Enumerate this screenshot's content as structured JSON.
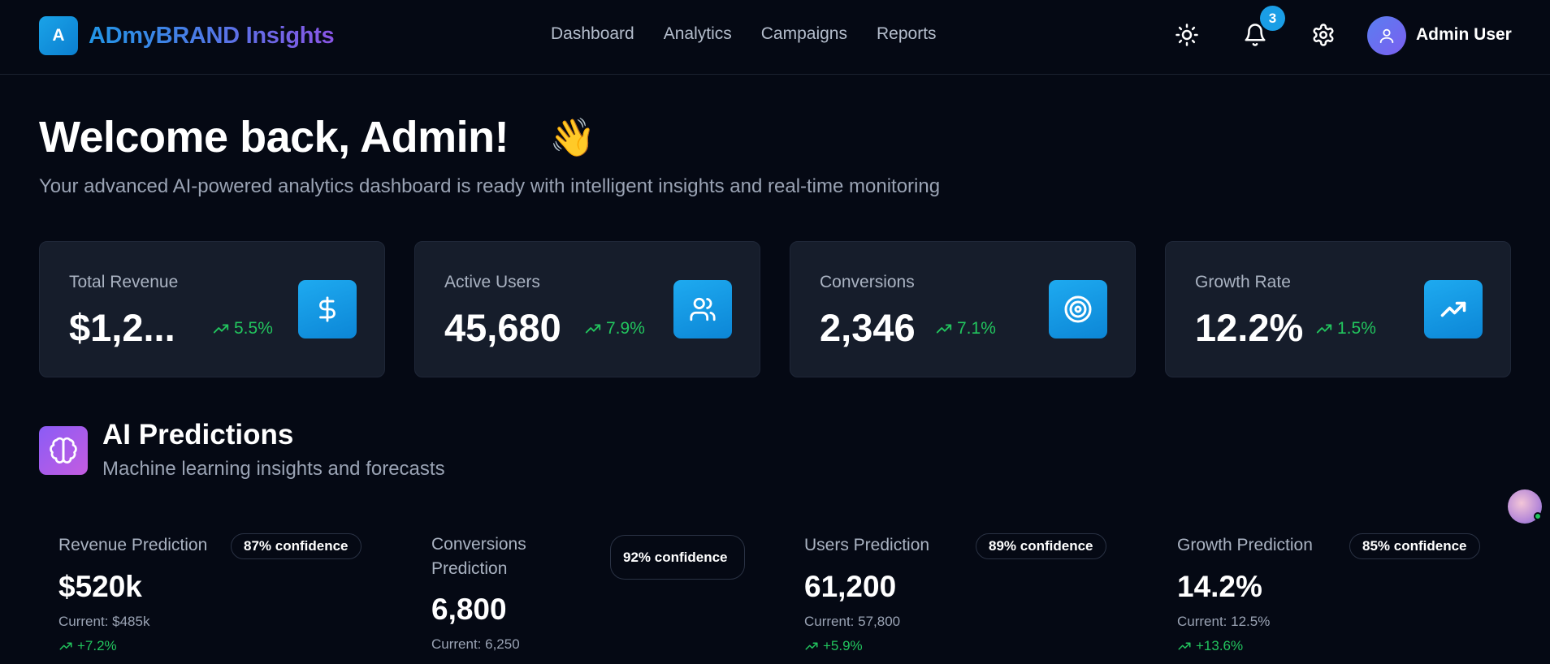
{
  "header": {
    "logo_letter": "A",
    "brand": "ADmyBRAND Insights",
    "nav": [
      "Dashboard",
      "Analytics",
      "Campaigns",
      "Reports"
    ],
    "notification_count": "3",
    "user_name": "Admin User",
    "icons": [
      "sun-icon",
      "bell-icon",
      "gear-icon",
      "user-icon"
    ]
  },
  "welcome": {
    "title": "Welcome back, Admin!",
    "emoji": "👋",
    "subtitle": "Your advanced AI-powered analytics dashboard is ready with intelligent insights and real-time monitoring"
  },
  "stats": [
    {
      "label": "Total Revenue",
      "value": "$1,2...",
      "trend": "5.5%",
      "icon": "dollar-icon"
    },
    {
      "label": "Active Users",
      "value": "45,680",
      "trend": "7.9%",
      "icon": "users-icon"
    },
    {
      "label": "Conversions",
      "value": "2,346",
      "trend": "7.1%",
      "icon": "target-icon"
    },
    {
      "label": "Growth Rate",
      "value": "12.2%",
      "trend": "1.5%",
      "icon": "trending-up-icon"
    }
  ],
  "ai": {
    "title": "AI Predictions",
    "subtitle": "Machine learning insights and forecasts",
    "predictions": [
      {
        "label": "Revenue Prediction",
        "confidence": "87% confidence",
        "value": "$520k",
        "current": "Current: $485k",
        "change": "+7.2%"
      },
      {
        "label": "Conversions Prediction",
        "confidence": "92% confidence",
        "value": "6,800",
        "current": "Current: 6,250",
        "change": ""
      },
      {
        "label": "Users Prediction",
        "confidence": "89% confidence",
        "value": "61,200",
        "current": "Current: 57,800",
        "change": "+5.9%"
      },
      {
        "label": "Growth Prediction",
        "confidence": "85% confidence",
        "value": "14.2%",
        "current": "Current: 12.5%",
        "change": "+13.6%"
      }
    ]
  },
  "colors": {
    "background": "#050914",
    "card": "#161d2b",
    "accent": "#1a9ee6",
    "positive": "#22c55e",
    "ai_gradient_start": "#8b5cf6"
  }
}
